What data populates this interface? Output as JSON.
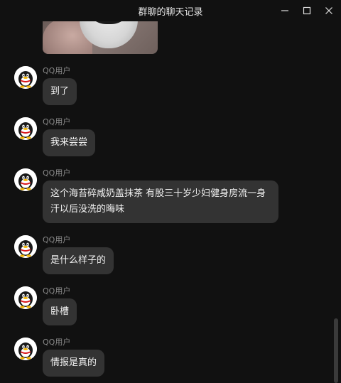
{
  "window": {
    "title": "群聊的聊天记录",
    "controls": {
      "minimize_icon": "minimize-icon",
      "maximize_icon": "maximize-icon",
      "close_icon": "close-icon"
    }
  },
  "colors": {
    "background": "#111111",
    "bubble": "#333333",
    "text": "#f2f2f2",
    "sender_name": "#8a8a8a"
  },
  "messages": [
    {
      "sender": "QQ用户",
      "avatar_icon": "qq-penguin-icon",
      "text": "到了"
    },
    {
      "sender": "QQ用户",
      "avatar_icon": "qq-penguin-icon",
      "text": "我来尝尝"
    },
    {
      "sender": "QQ用户",
      "avatar_icon": "qq-penguin-icon",
      "text": "这个海苔碎咸奶盖抹茶 有股三十岁少妇健身房流一身汗以后没洗的晦味"
    },
    {
      "sender": "QQ用户",
      "avatar_icon": "qq-penguin-icon",
      "text": "是什么样子的"
    },
    {
      "sender": "QQ用户",
      "avatar_icon": "qq-penguin-icon",
      "text": "卧槽"
    },
    {
      "sender": "QQ用户",
      "avatar_icon": "qq-penguin-icon",
      "text": "情报是真的"
    }
  ]
}
